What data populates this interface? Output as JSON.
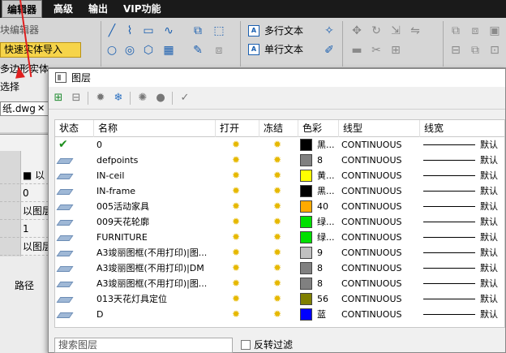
{
  "menubar": {
    "items": [
      "编辑器",
      "高级",
      "输出",
      "VIP功能"
    ]
  },
  "ribbon": {
    "text_items": [
      "多行文本",
      "单行文本"
    ]
  },
  "left_panel": {
    "block_editor": "块编辑器",
    "quick_import": "快速实体导入",
    "polygon": "多边形实体转换",
    "select": "选择",
    "file_tab": "纸.dwg",
    "prop_rows": [
      "■ 以",
      "0",
      "以图层",
      "1",
      "以图层"
    ],
    "path_label": "路径"
  },
  "dialog": {
    "title": "图层",
    "columns": [
      "状态",
      "名称",
      "打开",
      "冻结",
      "色彩",
      "线型",
      "线宽"
    ],
    "rows": [
      {
        "status": "check",
        "name": "0",
        "color_hex": "#000000",
        "color_name": "黑...",
        "linetype": "CONTINUOUS",
        "lineweight": "默认"
      },
      {
        "status": "sheet",
        "name": "defpoints",
        "color_hex": "#808080",
        "color_name": "8",
        "linetype": "CONTINUOUS",
        "lineweight": "默认"
      },
      {
        "status": "sheet",
        "name": "IN-ceil",
        "color_hex": "#ffff00",
        "color_name": "黄...",
        "linetype": "CONTINUOUS",
        "lineweight": "默认"
      },
      {
        "status": "sheet",
        "name": "IN-frame",
        "color_hex": "#000000",
        "color_name": "黑...",
        "linetype": "CONTINUOUS",
        "lineweight": "默认"
      },
      {
        "status": "sheet",
        "name": "005活动家具",
        "color_hex": "#ffaa00",
        "color_name": "40",
        "linetype": "CONTINUOUS",
        "lineweight": "默认"
      },
      {
        "status": "sheet",
        "name": "009天花轮廓",
        "color_hex": "#00e000",
        "color_name": "绿...",
        "linetype": "CONTINUOUS",
        "lineweight": "默认"
      },
      {
        "status": "sheet",
        "name": "FURNITURE",
        "color_hex": "#00e000",
        "color_name": "绿...",
        "linetype": "CONTINUOUS",
        "lineweight": "默认"
      },
      {
        "status": "sheet",
        "name": "A3竣丽图框(不用打印)|图...",
        "color_hex": "#c0c0c0",
        "color_name": "9",
        "linetype": "CONTINUOUS",
        "lineweight": "默认"
      },
      {
        "status": "sheet",
        "name": "A3竣丽图框(不用打印)|DM",
        "color_hex": "#808080",
        "color_name": "8",
        "linetype": "CONTINUOUS",
        "lineweight": "默认"
      },
      {
        "status": "sheet",
        "name": "A3竣丽图框(不用打印)|图...",
        "color_hex": "#808080",
        "color_name": "8",
        "linetype": "CONTINUOUS",
        "lineweight": "默认"
      },
      {
        "status": "sheet",
        "name": "013天花灯具定位",
        "color_hex": "#808000",
        "color_name": "56",
        "linetype": "CONTINUOUS",
        "lineweight": "默认"
      },
      {
        "status": "sheet",
        "name": "D",
        "color_hex": "#0000ff",
        "color_name": "蓝",
        "linetype": "CONTINUOUS",
        "lineweight": "默认"
      }
    ],
    "search_placeholder": "搜索图层",
    "invert_filter": "反转过滤"
  },
  "colors": {
    "accent_red": "#e02020",
    "quick_import_bg": "#f6d44a"
  }
}
